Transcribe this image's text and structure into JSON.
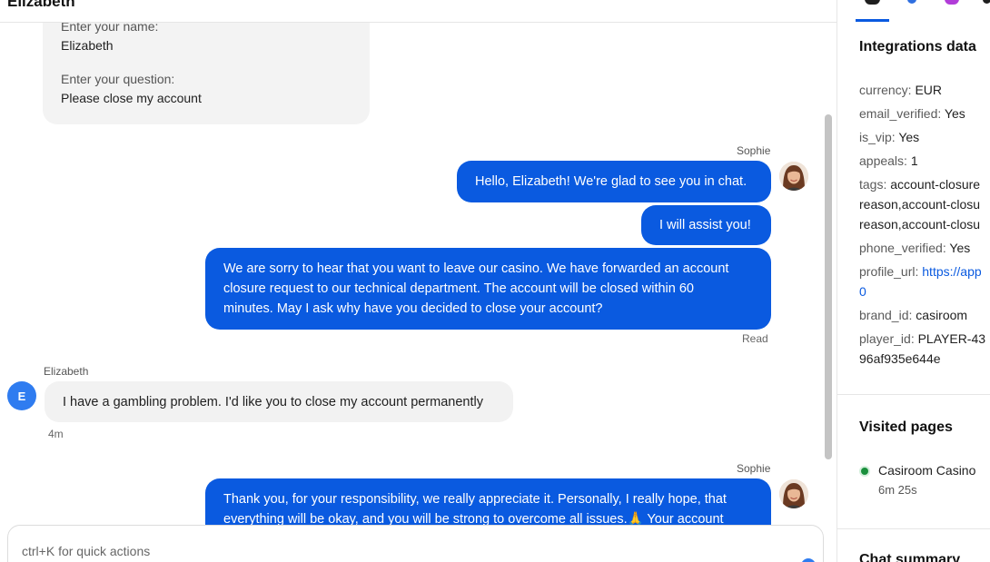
{
  "chat": {
    "contact_name": "Elizabeth",
    "form": {
      "name_label": "Enter your name:",
      "name_value": "Elizabeth",
      "question_label": "Enter your question:",
      "question_value": "Please close my account"
    },
    "messages": [
      {
        "sender": "Sophie",
        "direction": "outgoing",
        "text": "Hello, Elizabeth! We're glad to see you in chat."
      },
      {
        "direction": "outgoing",
        "text": "I will assist you!"
      },
      {
        "direction": "outgoing",
        "lines": [
          "We are sorry to hear that you want to leave our casino. We have forwarded an account",
          "closure request to our technical department. The account will be closed within 60",
          "minutes. May I ask why have you decided to close your account?"
        ],
        "status": "Read"
      },
      {
        "sender": "Elizabeth",
        "avatar_initial": "E",
        "direction": "incoming",
        "text": "I have a gambling problem. I'd like you to close my account permanently",
        "time": "4m"
      },
      {
        "sender": "Sophie",
        "direction": "outgoing",
        "lines": [
          "Thank you, for your responsibility, we really appreciate it. Personally, I really hope, that",
          "everything will be okay, and you will be strong to overcome all issues.🙏 Your account"
        ]
      }
    ],
    "composer_placeholder": "ctrl+K for quick actions"
  },
  "sidebar": {
    "integrations_title": "Integrations data",
    "fields": [
      {
        "key": "currency:",
        "value": "EUR"
      },
      {
        "key": "email_verified:",
        "value": "Yes"
      },
      {
        "key": "is_vip:",
        "value": "Yes"
      },
      {
        "key": "appeals:",
        "value": "1"
      },
      {
        "key": "tags:",
        "value": "account-closure",
        "cont": [
          "reason,account-closu",
          "reason,account-closu"
        ]
      },
      {
        "key": "phone_verified:",
        "value": "Yes"
      },
      {
        "key": "profile_url:",
        "value": "https://app",
        "cont": [
          "0"
        ]
      },
      {
        "key": "brand_id:",
        "value": "casiroom"
      },
      {
        "key": "player_id:",
        "value": "PLAYER-43",
        "cont": [
          "96af935e644e"
        ]
      }
    ],
    "visited_title": "Visited pages",
    "visited": [
      {
        "page": "Casiroom Casino",
        "duration": "6m 25s"
      }
    ],
    "summary_title": "Chat summary",
    "colors": {
      "accent": "#0a5ae0",
      "online": "#1a8f3c"
    }
  }
}
